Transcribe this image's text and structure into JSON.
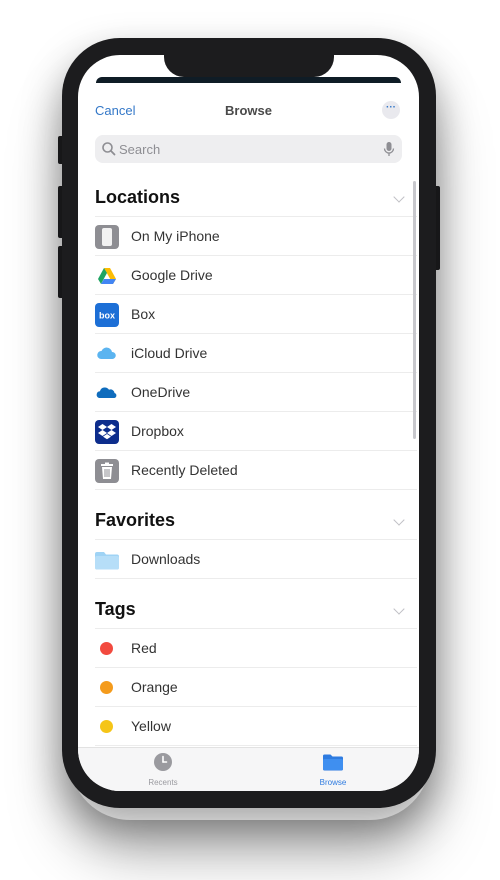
{
  "navbar": {
    "cancel_label": "Cancel",
    "title": "Browse",
    "more_icon": "ellipsis-icon",
    "more_label": "···"
  },
  "search": {
    "placeholder": "Search",
    "value": ""
  },
  "sections": {
    "locations": {
      "title": "Locations",
      "items": [
        {
          "label": "On My iPhone",
          "icon": "iphone-icon"
        },
        {
          "label": "Google Drive",
          "icon": "google-drive-icon"
        },
        {
          "label": "Box",
          "icon": "box-icon",
          "icon_text": "box"
        },
        {
          "label": "iCloud Drive",
          "icon": "icloud-icon"
        },
        {
          "label": "OneDrive",
          "icon": "onedrive-icon"
        },
        {
          "label": "Dropbox",
          "icon": "dropbox-icon"
        },
        {
          "label": "Recently Deleted",
          "icon": "trash-icon"
        }
      ]
    },
    "favorites": {
      "title": "Favorites",
      "items": [
        {
          "label": "Downloads",
          "icon": "folder-icon"
        }
      ]
    },
    "tags": {
      "title": "Tags",
      "items": [
        {
          "label": "Red",
          "color": "#f24a3f"
        },
        {
          "label": "Orange",
          "color": "#f49b1c"
        },
        {
          "label": "Yellow",
          "color": "#f5c518"
        }
      ]
    }
  },
  "tabbar": {
    "recents_label": "Recents",
    "browse_label": "Browse",
    "active": "Browse"
  },
  "colors": {
    "accent": "#3478c8",
    "active_tab": "#2e7be0",
    "box_brand": "#1d6fd6",
    "dropbox_brand": "#0d2d8c",
    "phone_body": "#1c1c1e"
  }
}
